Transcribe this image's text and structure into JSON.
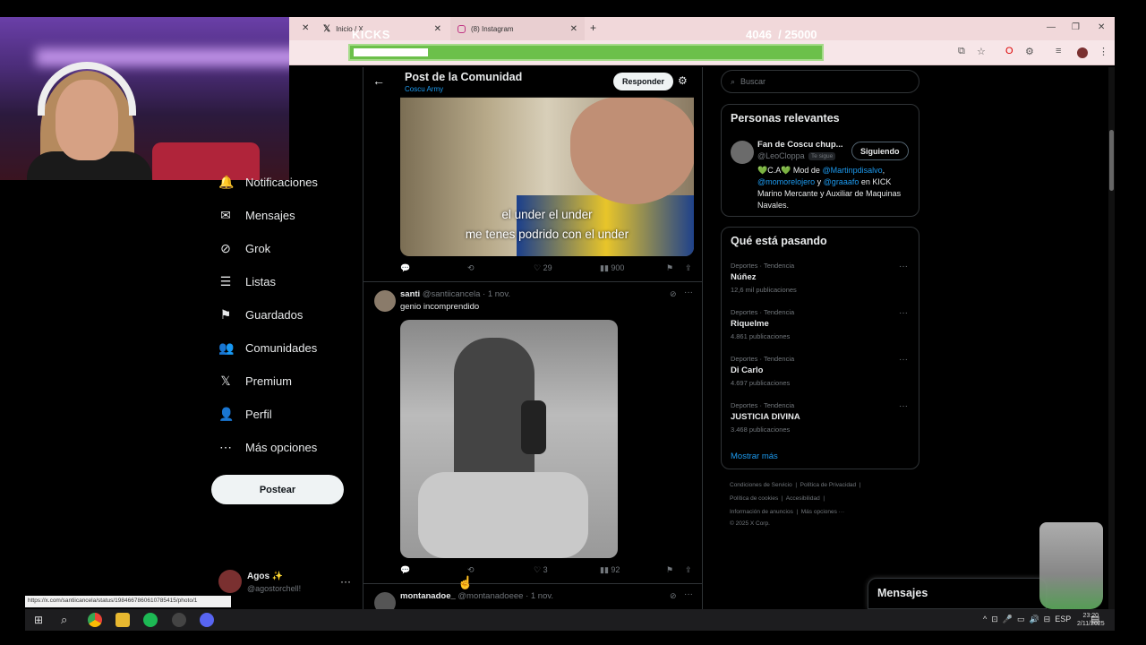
{
  "browser": {
    "tabs": [
      {
        "label": "Inicio / X",
        "icon": "x-logo-icon"
      },
      {
        "label": "(8) Instagram",
        "icon": "instagram-icon"
      }
    ],
    "new_tab": "+"
  },
  "overlay": {
    "kick_label": "KICKS",
    "kick_count": "4046",
    "kick_goal": "/ 25000",
    "progress": 0.16
  },
  "nav": {
    "items": [
      {
        "label": "Notificaciones",
        "icon": "bell-icon"
      },
      {
        "label": "Mensajes",
        "icon": "envelope-icon"
      },
      {
        "label": "Grok",
        "icon": "grok-icon"
      },
      {
        "label": "Listas",
        "icon": "list-icon"
      },
      {
        "label": "Guardados",
        "icon": "bookmark-icon"
      },
      {
        "label": "Comunidades",
        "icon": "people-icon"
      },
      {
        "label": "Premium",
        "icon": "x-logo-icon"
      },
      {
        "label": "Perfil",
        "icon": "person-icon"
      },
      {
        "label": "Más opciones",
        "icon": "more-circle-icon"
      }
    ],
    "post_button": "Postear",
    "account": {
      "name": "Agos ✨",
      "handle": "@agostorchell!"
    }
  },
  "main": {
    "header_title": "Post de la Comunidad",
    "header_sub": "Coscu Army",
    "reply_button": "Responder",
    "video": {
      "subtitle_line1": "el under el under",
      "subtitle_line2": "me tenes podrido con el under"
    },
    "post1_actions": {
      "retweets": "",
      "likes": "29",
      "views": "900"
    },
    "post2": {
      "name": "santi",
      "handle": "@santiicancela",
      "time": "· 1 nov.",
      "text": "genio incomprendido",
      "likes": "3",
      "views": "92"
    },
    "post3": {
      "name": "montanadoe_",
      "handle": "@montanadoeee",
      "time": "· 1 nov."
    }
  },
  "right": {
    "search_placeholder": "Buscar",
    "relevant_title": "Personas relevantes",
    "person": {
      "name": "Fan de Coscu chup...",
      "handle": "@LeoCloppa",
      "badge": "Te sigue",
      "follow_label": "Siguiendo",
      "bio_a": "💚C.A💚 Mod de ",
      "bio_link1": "@Martinpdisalvo",
      "bio_b": ",",
      "bio_link2": "@momorelojero",
      "bio_c": " y ",
      "bio_link3": "@graaafo",
      "bio_d": " en KICK Marino Mercante y Auxiliar de Maquinas Navales."
    },
    "trends_title": "Qué está pasando",
    "trends": [
      {
        "category": "Deportes · Tendencia",
        "name": "Núñez",
        "count": "12,6 mil publicaciones"
      },
      {
        "category": "Deportes · Tendencia",
        "name": "Riquelme",
        "count": "4.861 publicaciones"
      },
      {
        "category": "Deportes · Tendencia",
        "name": "Di Carlo",
        "count": "4.697 publicaciones"
      },
      {
        "category": "Deportes · Tendencia",
        "name": "JUSTICIA DIVINA",
        "count": "3.468 publicaciones"
      }
    ],
    "show_more": "Mostrar más",
    "footer": {
      "line1a": "Condiciones de Servicio",
      "line1b": "Política de Privacidad",
      "line2a": "Política de cookies",
      "line2b": "Accesibilidad",
      "line3a": "Información de anuncios",
      "line3b": "Más opciones ···",
      "line4": "© 2025 X Corp."
    }
  },
  "messages_dock": "Mensajes",
  "status_url": "https://x.com/santiicancela/status/1984667860610785415/photo/1",
  "taskbar": {
    "lang": "ESP",
    "time": "23:20",
    "date": "2/11/2025"
  },
  "colors": {
    "accent": "#1d9bf0",
    "kick_green": "#6cc04a",
    "bg": "#000000"
  }
}
